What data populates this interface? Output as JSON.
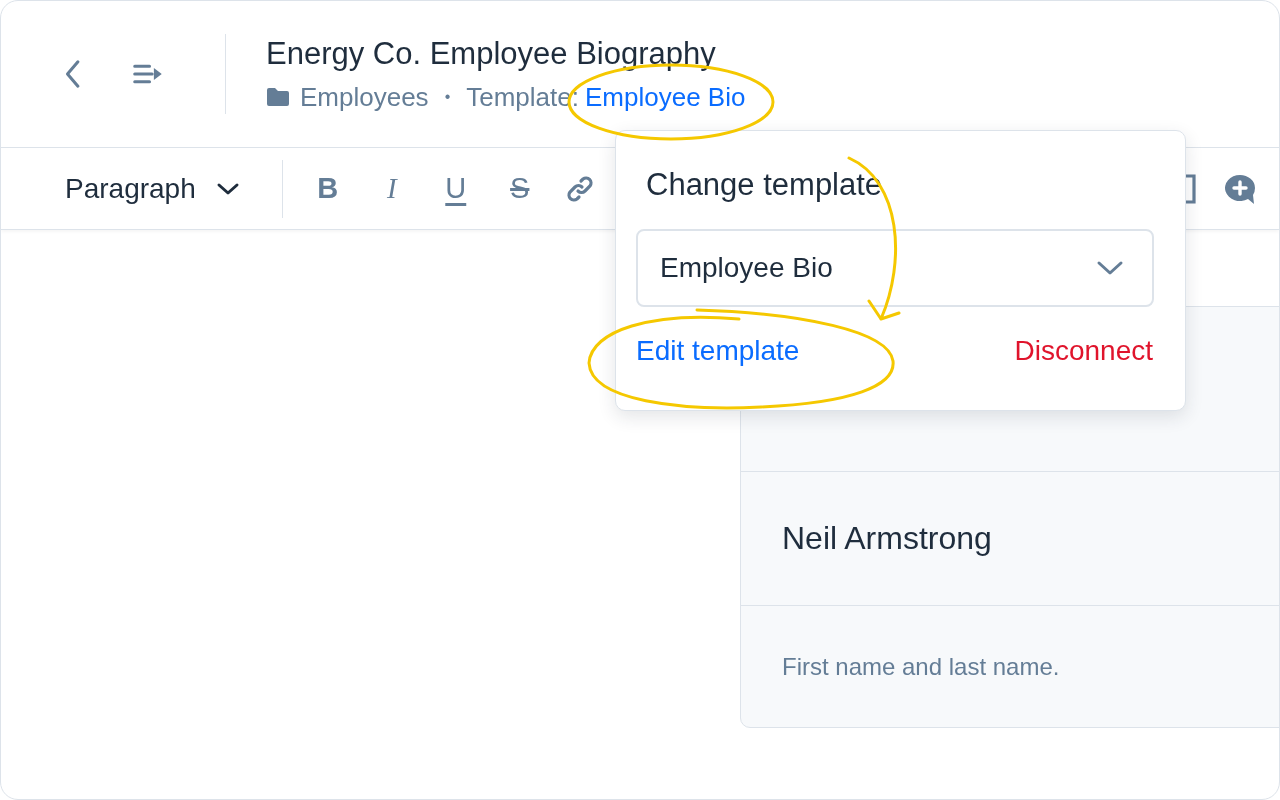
{
  "header": {
    "title": "Energy Co. Employee Biography",
    "folder": "Employees",
    "separator": "•",
    "template_label": "Template:",
    "template_link": "Employee Bio"
  },
  "toolbar": {
    "block_style": "Paragraph",
    "tools": [
      {
        "kind": "bold",
        "glyph": "B"
      },
      {
        "kind": "italic",
        "glyph": "I"
      },
      {
        "kind": "underline",
        "glyph": "U"
      },
      {
        "kind": "strike",
        "glyph": "S"
      },
      {
        "kind": "link"
      }
    ],
    "end_tools": [
      {
        "kind": "bracket"
      },
      {
        "kind": "comment"
      }
    ]
  },
  "popover": {
    "title": "Change template",
    "select_value": "Employee Bio",
    "edit_link": "Edit template",
    "disconnect": "Disconnect"
  },
  "panel": {
    "rows": [
      {
        "kind": "value",
        "text": "Neil Armstrong"
      },
      {
        "kind": "hint",
        "text": "First name and last name."
      }
    ]
  }
}
